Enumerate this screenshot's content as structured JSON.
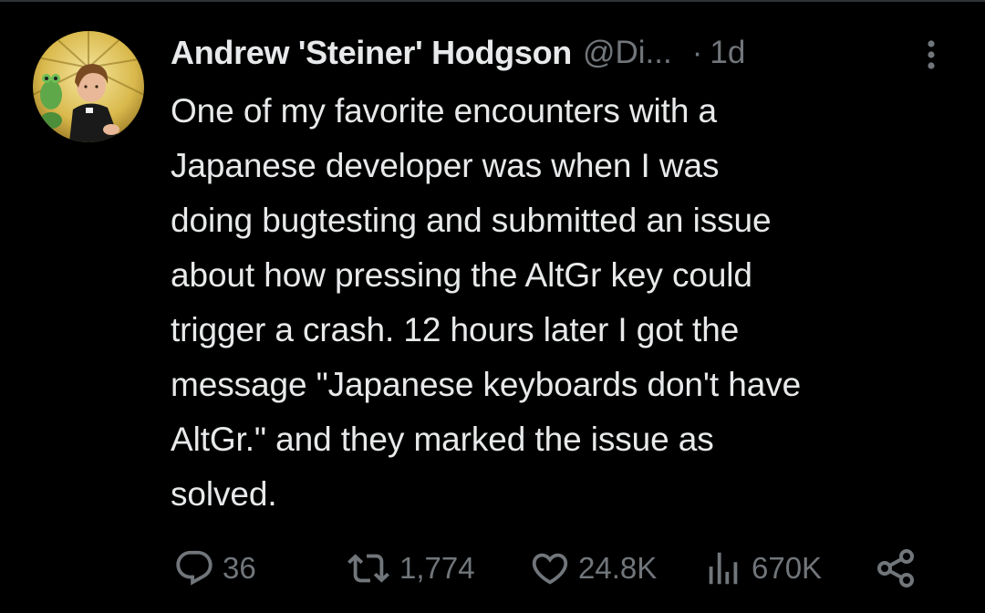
{
  "author": {
    "display_name": "Andrew 'Steiner' Hodgson",
    "handle": "@Di...",
    "separator": "·",
    "time_ago": "1d"
  },
  "tweet": {
    "lines": [
      "One of my favorite encounters with a",
      "Japanese developer was when I was",
      "doing bugtesting and submitted an issue",
      "about how pressing the AltGr key could",
      "trigger a crash. 12 hours later I got the",
      "message \"Japanese keyboards don't have",
      "AltGr.\" and they marked the issue as",
      "solved."
    ]
  },
  "actions": {
    "replies": "36",
    "reposts": "1,774",
    "likes": "24.8K",
    "views": "670K"
  },
  "icons": {
    "reply": "reply-icon",
    "repost": "repost-icon",
    "like": "heart-icon",
    "views": "views-icon",
    "share": "share-icon",
    "more": "more-vertical-icon"
  },
  "colors": {
    "background": "#000000",
    "text_primary": "#e7e9ea",
    "text_secondary": "#71767b"
  }
}
